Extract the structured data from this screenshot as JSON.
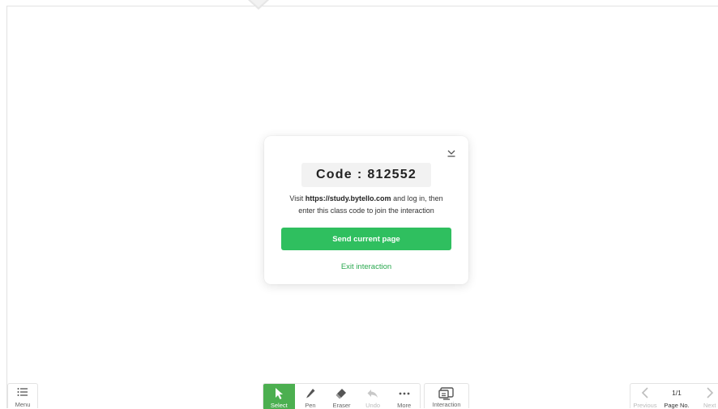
{
  "dialog": {
    "code_label": "Code",
    "code_separator": ":",
    "code_value": "812552",
    "visit_prefix": "Visit ",
    "visit_url": "https://study.bytello.com",
    "visit_suffix": " and log in, then",
    "instruction_line2": "enter this class code to join the interaction",
    "send_button": "Send current page",
    "exit_link": "Exit interaction",
    "collapse_icon": "collapse-down-icon"
  },
  "menu": {
    "label": "Menu",
    "icon": "list-icon"
  },
  "toolbar": {
    "tools": [
      {
        "label": "Select",
        "icon": "cursor-icon",
        "active": true
      },
      {
        "label": "Pen",
        "icon": "pen-icon"
      },
      {
        "label": "Eraser",
        "icon": "eraser-icon"
      },
      {
        "label": "Undo",
        "icon": "undo-icon",
        "disabled": true
      },
      {
        "label": "More",
        "icon": "more-dots-icon"
      }
    ]
  },
  "interaction": {
    "label": "Interaction",
    "icon": "interaction-screen-icon"
  },
  "pager": {
    "previous_label": "Previous",
    "page_no_label": "Page No.",
    "page_value": "1/1",
    "next_label": "Next"
  },
  "colors": {
    "accent_green": "#2fbf5f",
    "active_tool": "#4caf50",
    "link_green": "#2aa84f"
  }
}
